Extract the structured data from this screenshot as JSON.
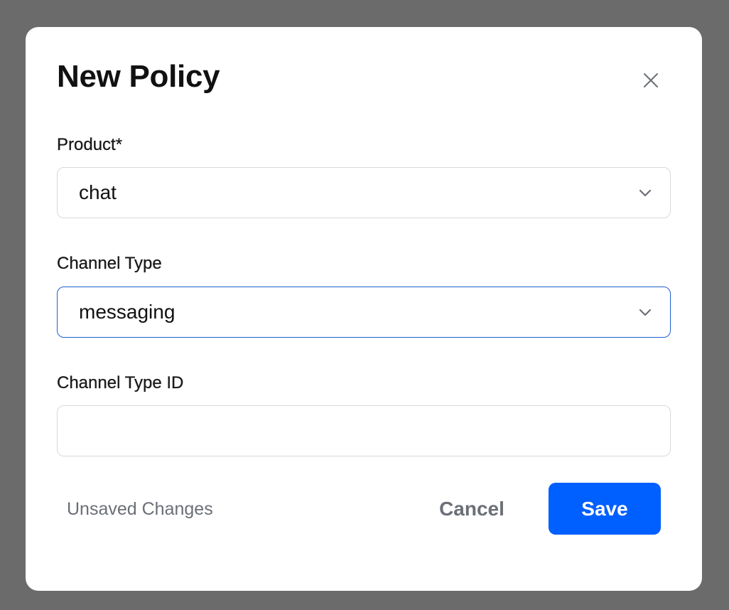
{
  "modal": {
    "title": "New Policy"
  },
  "fields": {
    "product": {
      "label": "Product*",
      "value": "chat"
    },
    "channel_type": {
      "label": "Channel Type",
      "value": "messaging"
    },
    "channel_type_id": {
      "label": "Channel Type ID",
      "value": "",
      "placeholder": ""
    }
  },
  "footer": {
    "status_text": "Unsaved Changes",
    "cancel_label": "Cancel",
    "save_label": "Save"
  },
  "colors": {
    "accent": "#005fff",
    "focus_border": "#1f5fd1",
    "muted_text": "#6b6f76",
    "overlay": "#6b6b6b"
  },
  "icons": {
    "close": "close-icon",
    "dropdown": "chevron-down-icon"
  }
}
